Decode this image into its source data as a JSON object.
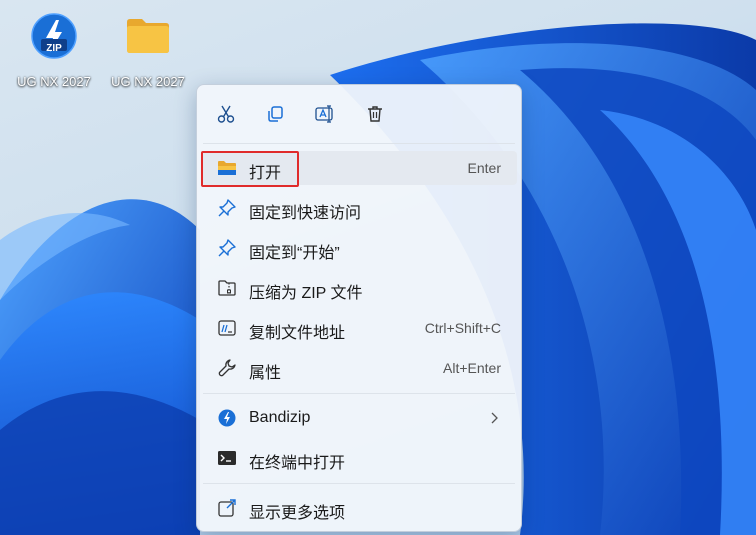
{
  "desktop": {
    "icons": [
      {
        "label": "UG NX 2027",
        "icon": "zip-archive-icon",
        "badge": "ZIP"
      },
      {
        "label": "UG NX 2027",
        "icon": "folder-icon"
      }
    ]
  },
  "context_menu": {
    "toolbar": [
      "cut-icon",
      "copy-icon",
      "rename-icon",
      "delete-icon"
    ],
    "items": [
      {
        "label": "打开",
        "shortcut": "Enter",
        "icon": "folder-icon",
        "highlighted": true
      },
      {
        "label": "固定到快速访问",
        "shortcut": "",
        "icon": "pin-icon"
      },
      {
        "label": "固定到“开始”",
        "shortcut": "",
        "icon": "pin-icon"
      },
      {
        "label": "压缩为 ZIP 文件",
        "shortcut": "",
        "icon": "zip-folder-icon"
      },
      {
        "label": "复制文件地址",
        "shortcut": "Ctrl+Shift+C",
        "icon": "copy-path-icon"
      },
      {
        "label": "属性",
        "shortcut": "Alt+Enter",
        "icon": "wrench-icon"
      },
      {
        "label": "Bandizip",
        "shortcut": "",
        "icon": "bandizip-icon",
        "submenu": true
      },
      {
        "label": "在终端中打开",
        "shortcut": "",
        "icon": "terminal-icon"
      },
      {
        "label": "显示更多选项",
        "shortcut": "",
        "icon": "more-options-icon"
      }
    ]
  },
  "colors": {
    "accent": "#1a6fd6",
    "highlight_border": "#e02b2b",
    "folder_yellow": "#f7c444"
  }
}
